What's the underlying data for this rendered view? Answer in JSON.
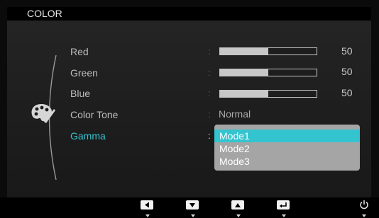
{
  "osd": {
    "title": "COLOR",
    "menu": [
      {
        "label": "Red",
        "value": 50,
        "max": 100,
        "value_text": "50"
      },
      {
        "label": "Green",
        "value": 50,
        "max": 100,
        "value_text": "50"
      },
      {
        "label": "Blue",
        "value": 50,
        "max": 100,
        "value_text": "50"
      },
      {
        "label": "Color Tone",
        "value_text": "Normal"
      },
      {
        "label": "Gamma",
        "selected": true
      }
    ],
    "separator": ":",
    "gamma_options": [
      "Mode1",
      "Mode2",
      "Mode3"
    ],
    "gamma_selected_index": 0,
    "side_icon": "color-palette-icon"
  },
  "footer": {
    "buttons": [
      {
        "icon": "left-arrow-key-icon"
      },
      {
        "icon": "down-arrow-key-icon"
      },
      {
        "icon": "up-arrow-key-icon"
      },
      {
        "icon": "enter-key-icon"
      },
      {
        "icon": "power-icon"
      }
    ]
  },
  "colors": {
    "accent": "#33c4cf",
    "text": "#bdbdbd",
    "dropdown_bg": "#a5a5a5"
  }
}
